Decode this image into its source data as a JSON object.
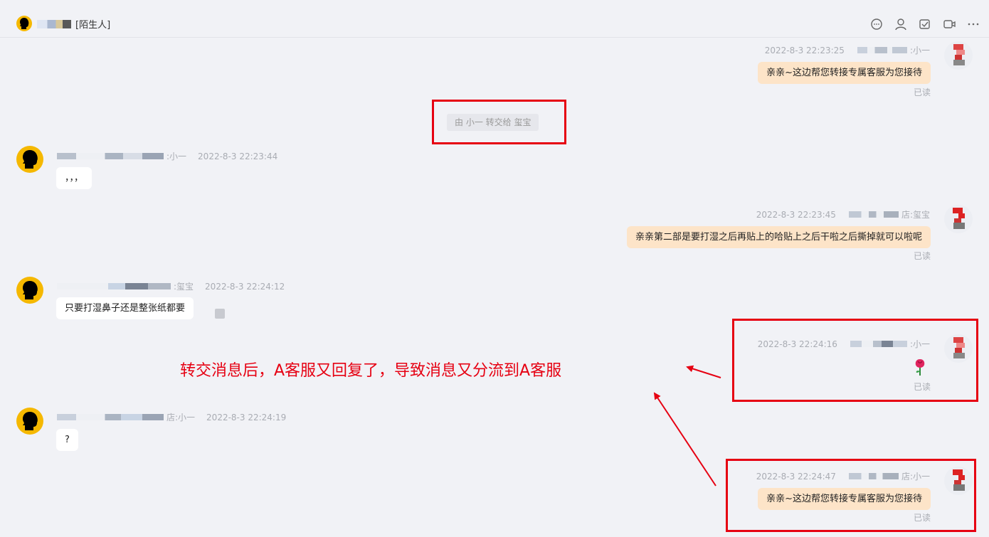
{
  "header": {
    "contact_tag": "[陌生人]",
    "icons": [
      "chat-bubble-icon",
      "user-icon",
      "task-check-icon",
      "video-icon",
      "more-icon"
    ]
  },
  "system_notice": "由 小一 转交给 玺宝",
  "annotation": "转交消息后，A客服又回复了，导致消息又分流到A客服",
  "messages": [
    {
      "side": "right",
      "time": "2022-8-3 22:23:25",
      "sender_suffix": ":小一",
      "text": "亲亲~这边帮您转接专属客服为您接待",
      "status": "已读"
    },
    {
      "side": "left",
      "time": "2022-8-3 22:23:44",
      "sender_suffix": ":小一",
      "text": "，，，"
    },
    {
      "side": "right",
      "time": "2022-8-3 22:23:45",
      "sender_suffix": "店:玺宝",
      "text": "亲亲第二部是要打湿之后再贴上的哈贴上之后干啦之后撕掉就可以啦呢",
      "status": "已读"
    },
    {
      "side": "left",
      "time": "2022-8-3 22:24:12",
      "sender_suffix": ":玺宝",
      "text": "只要打湿鼻子还是整张纸都要"
    },
    {
      "side": "right",
      "time": "2022-8-3 22:24:16",
      "sender_suffix": ":小一",
      "text": "",
      "status": "已读",
      "emoji": "rose-icon"
    },
    {
      "side": "left",
      "time": "2022-8-3 22:24:19",
      "sender_suffix": "店:小一",
      "text": "?"
    },
    {
      "side": "right",
      "time": "2022-8-3 22:24:47",
      "sender_suffix": "店:小一",
      "text": "亲亲~这边帮您转接专属客服为您接待",
      "status": "已读"
    }
  ],
  "colors": {
    "accent_red": "#e60012",
    "bubble_self": "#fde4c8",
    "avatar_yellow": "#f5b800"
  }
}
